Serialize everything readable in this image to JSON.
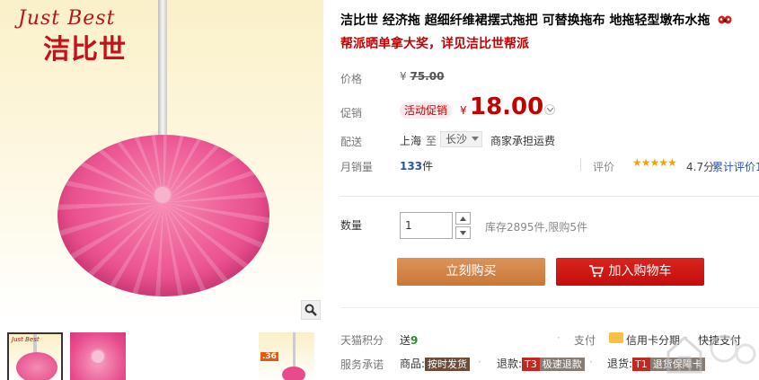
{
  "gallery": {
    "brand_en": "Just Best",
    "brand_cn": "洁比世",
    "zoom_icon": "magnifier-icon",
    "thumb3_price": ".36"
  },
  "product": {
    "title": "洁比世 经济拖 超细纤维裙摆式拖把 可替换拖布 地拖轻型墩布水拖",
    "subtitle": "帮派晒单拿大奖，详见洁比世帮派"
  },
  "price": {
    "label": "价格",
    "currency": "¥",
    "original": "75.00",
    "promo_label": "促销",
    "promo_tag": "活动促销",
    "promo_price": "18.00"
  },
  "shipping": {
    "label": "配送",
    "from": "上海",
    "to": "至",
    "city": "长沙",
    "freight": "商家承担运费"
  },
  "sales": {
    "label": "月销量",
    "count": "133",
    "unit": "件",
    "rating_label": "评价",
    "stars": "★★★★★",
    "rating": "4.7分",
    "rating_link": "累计评价1"
  },
  "purchase": {
    "qty_label": "数量",
    "qty_value": "1",
    "stock": "库存2895件,限购5件",
    "buy_now": "立刻购买",
    "add_cart": "加入购物车"
  },
  "service": {
    "points_label": "天猫积分",
    "points_prefix": "送",
    "points": "9",
    "pay_label": "支付",
    "card_installment": "信用卡分期",
    "quick_pay": "快捷支付",
    "promise_label": "服务承诺",
    "item1_label": "商品:",
    "item1_tag": "按时发货",
    "item2_label": "退款:",
    "item2_tag_code": "T3",
    "item2_tag": "极速退款",
    "item3_label": "退货:",
    "item3_tag_code": "T1",
    "item3_tag": "退货保障卡"
  },
  "colors": {
    "price_red": "#c40000",
    "buy_button": "#d5874c",
    "cart_button": "#c30d0d",
    "mop_pink": "#ee5d97"
  }
}
